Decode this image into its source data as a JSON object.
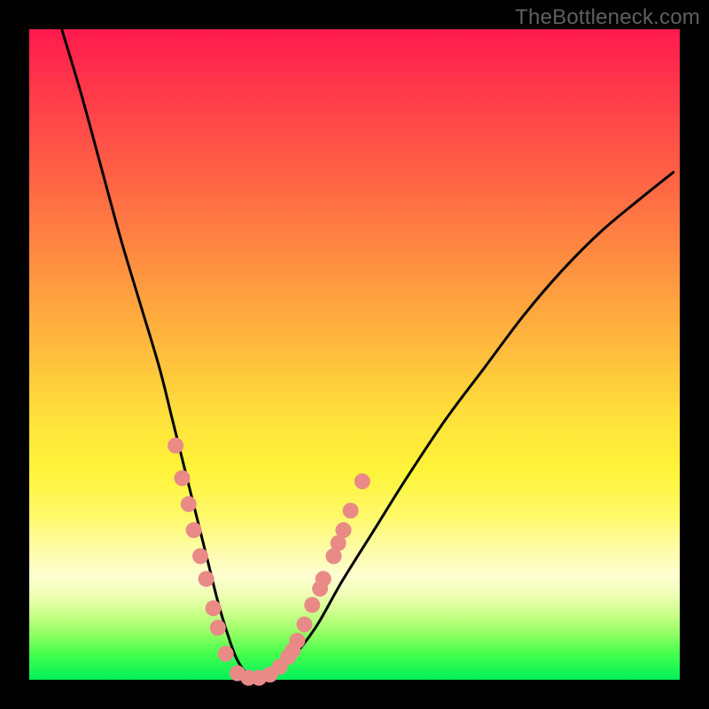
{
  "watermark": "TheBottleneck.com",
  "colors": {
    "curve": "#000000",
    "dot_fill": "#e98a87",
    "dot_stroke": "#c76a66"
  },
  "chart_data": {
    "type": "line",
    "title": "",
    "xlabel": "",
    "ylabel": "",
    "xlim": [
      0,
      100
    ],
    "ylim": [
      0,
      100
    ],
    "grid": false,
    "series": [
      {
        "name": "bottleneck-curve",
        "x": [
          5,
          8,
          11,
          14,
          17,
          20,
          22,
          24,
          26,
          27.5,
          29,
          30.5,
          32,
          34,
          36.5,
          40,
          44,
          48,
          53,
          58,
          64,
          70,
          76,
          82,
          88,
          94,
          99
        ],
        "y": [
          100,
          90,
          79,
          68,
          58,
          48,
          40,
          32,
          24,
          18,
          12,
          7,
          3,
          0.5,
          0.5,
          3,
          8,
          15,
          23,
          31,
          40,
          48,
          56,
          63,
          69,
          74,
          78
        ]
      }
    ],
    "markers": {
      "name": "highlighted-points",
      "points_xy": [
        [
          22.5,
          36
        ],
        [
          23.5,
          31
        ],
        [
          24.5,
          27
        ],
        [
          25.3,
          23
        ],
        [
          26.3,
          19
        ],
        [
          27.2,
          15.5
        ],
        [
          28.3,
          11
        ],
        [
          29.0,
          8
        ],
        [
          30.2,
          4
        ],
        [
          32.0,
          1
        ],
        [
          33.7,
          0.3
        ],
        [
          35.3,
          0.3
        ],
        [
          37.0,
          0.8
        ],
        [
          38.5,
          2
        ],
        [
          39.8,
          3.5
        ],
        [
          40.5,
          4.5
        ],
        [
          41.2,
          6
        ],
        [
          42.3,
          8.5
        ],
        [
          43.5,
          11.5
        ],
        [
          44.7,
          14
        ],
        [
          45.2,
          15.5
        ],
        [
          46.8,
          19
        ],
        [
          47.5,
          21
        ],
        [
          48.3,
          23
        ],
        [
          49.4,
          26
        ],
        [
          51.2,
          30.5
        ]
      ]
    }
  }
}
